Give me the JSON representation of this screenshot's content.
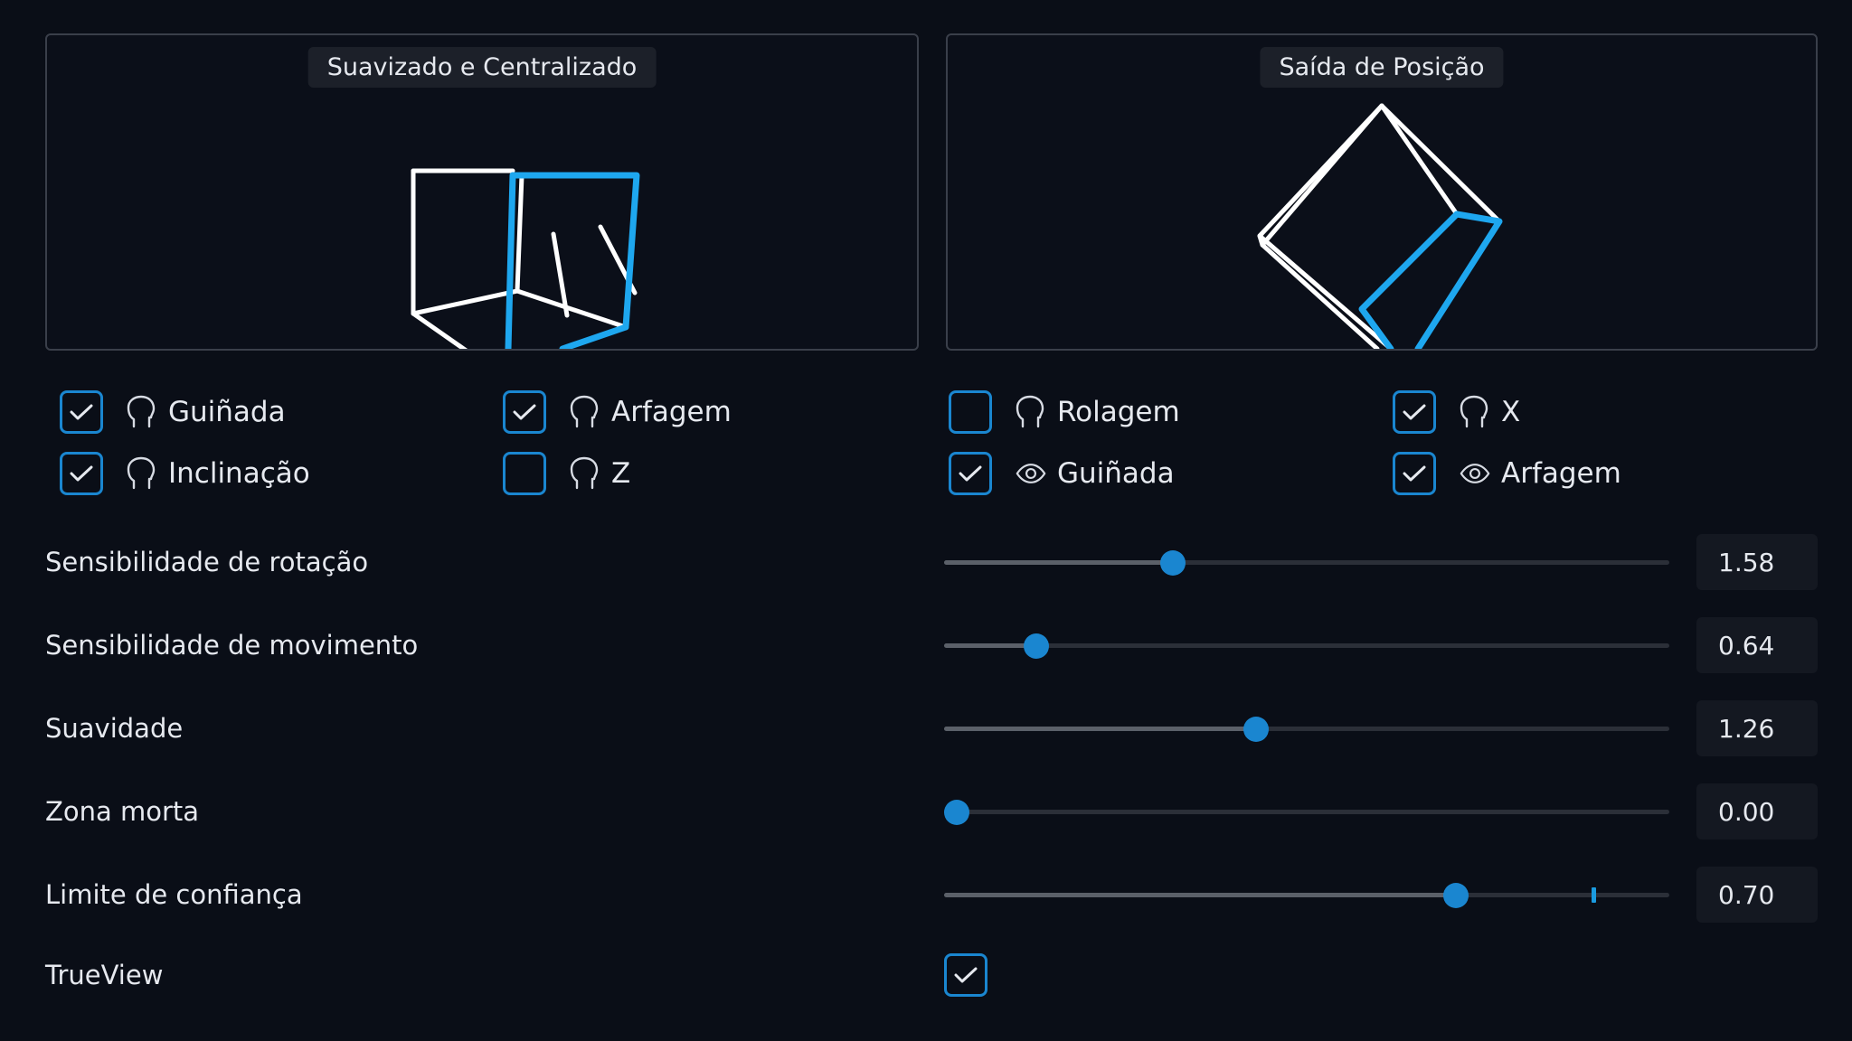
{
  "panels": {
    "left_title": "Suavizado e Centralizado",
    "right_title": "Saída de Posição"
  },
  "toggles": [
    {
      "label": "Guiñada",
      "checked": true,
      "icon": "head-icon"
    },
    {
      "label": "Arfagem",
      "checked": true,
      "icon": "head-icon"
    },
    {
      "label": "Rolagem",
      "checked": false,
      "icon": "head-icon"
    },
    {
      "label": "X",
      "checked": true,
      "icon": "head-icon"
    },
    {
      "label": "Inclinação",
      "checked": true,
      "icon": "head-icon"
    },
    {
      "label": "Z",
      "checked": false,
      "icon": "head-icon"
    },
    {
      "label": "Guiñada",
      "checked": true,
      "icon": "eye-icon"
    },
    {
      "label": "Arfagem",
      "checked": true,
      "icon": "eye-icon"
    }
  ],
  "sliders": [
    {
      "label": "Sensibilidade de rotação",
      "value": "1.58",
      "level": 0.315
    },
    {
      "label": "Sensibilidade de movimento",
      "value": "0.64",
      "level": 0.127
    },
    {
      "label": "Suavidade",
      "value": "1.26",
      "level": 0.43
    },
    {
      "label": "Zona morta",
      "value": "0.00",
      "level": 0.018
    },
    {
      "label": "Limite de confiança",
      "value": "0.70",
      "level": 0.706,
      "marker_level": 0.895
    }
  ],
  "trueview": {
    "label": "TrueView",
    "checked": true
  },
  "colors": {
    "accent": "#1a86d0",
    "cube_blue": "#1ea7ef",
    "background": "#0a0e17"
  }
}
